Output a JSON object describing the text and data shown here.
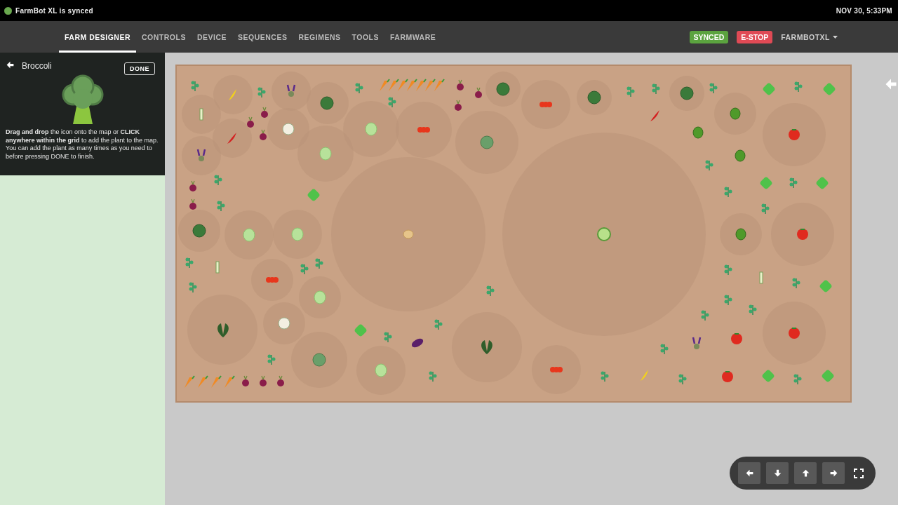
{
  "top_bar": {
    "status_text": "FarmBot XL is synced",
    "synced": true,
    "datetime": "NOV 30, 5:33PM"
  },
  "nav": {
    "tabs": [
      {
        "label": "FARM DESIGNER",
        "selected": true
      },
      {
        "label": "CONTROLS",
        "selected": false
      },
      {
        "label": "DEVICE",
        "selected": false
      },
      {
        "label": "SEQUENCES",
        "selected": false
      },
      {
        "label": "REGIMENS",
        "selected": false
      },
      {
        "label": "TOOLS",
        "selected": false
      },
      {
        "label": "FARMWARE",
        "selected": false
      }
    ],
    "sync_button": "SYNCED",
    "estop_button": "E-STOP",
    "account_menu": "FARMBOTXL"
  },
  "panel": {
    "title": "Broccoli",
    "done_button": "DONE",
    "instructions": "**Drag and drop** the icon onto the map or **CLICK anywhere within the grid** to add the plant to the map. You can add the plant as many times as you need to before pressing DONE to finish."
  }
}
